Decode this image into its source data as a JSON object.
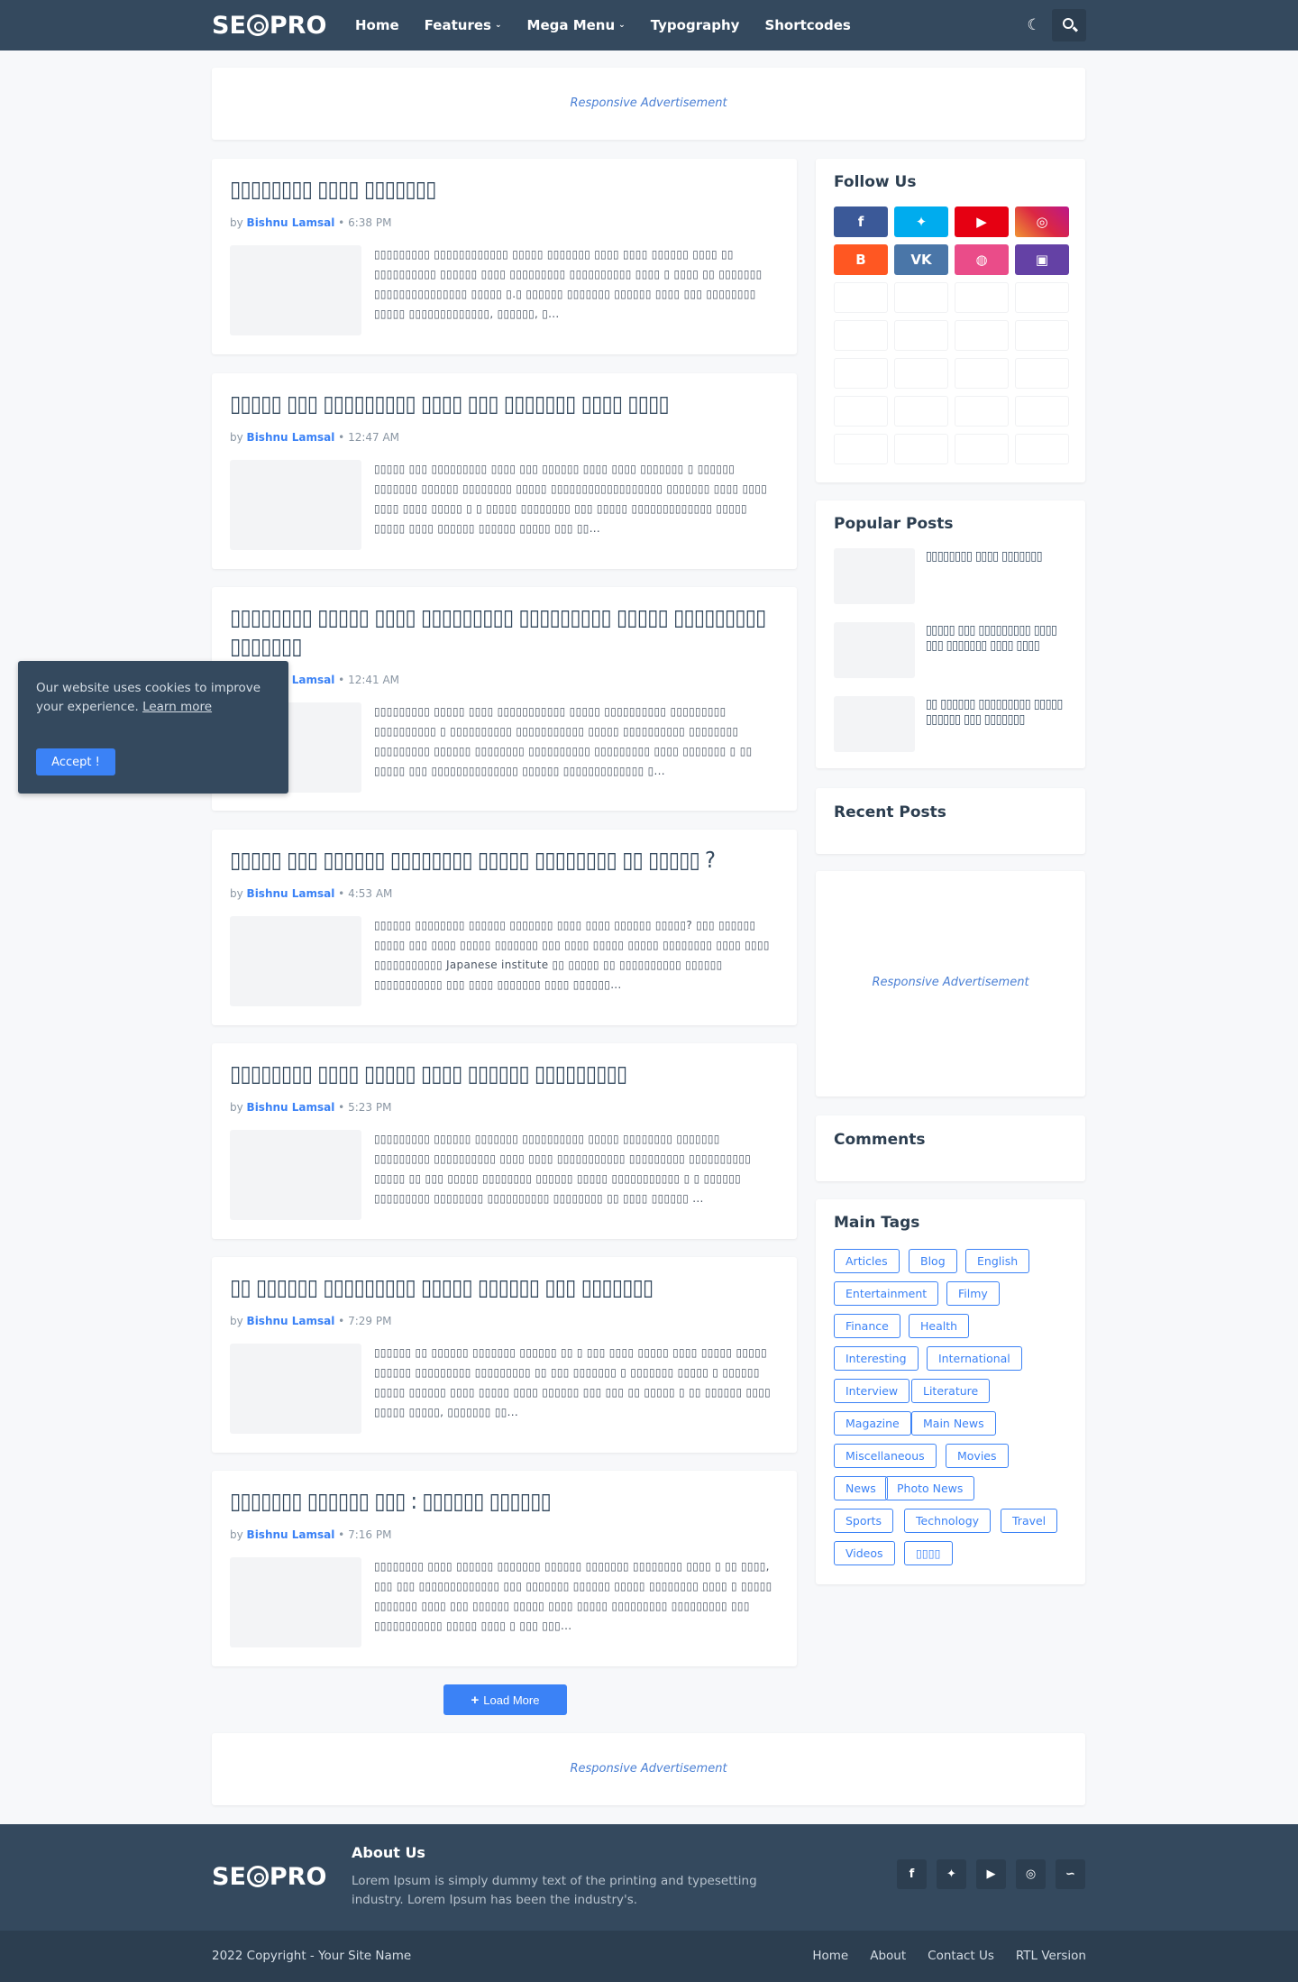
{
  "header": {
    "logo": {
      "left": "SE",
      "right": "PRO"
    },
    "nav": [
      {
        "label": "Home",
        "dropdown": false
      },
      {
        "label": "Features",
        "dropdown": true
      },
      {
        "label": "Mega Menu",
        "dropdown": true
      },
      {
        "label": "Typography",
        "dropdown": false
      },
      {
        "label": "Shortcodes",
        "dropdown": false
      }
    ],
    "icons": {
      "theme": "moon-icon",
      "search": "search-icon"
    }
  },
  "ads": {
    "top": "Responsive Advertisement",
    "sidebar": "Responsive Advertisement",
    "bottom": "Responsive Advertisement"
  },
  "posts": [
    {
      "title": "▯▯▯▯▯▯▯▯ ▯▯▯▯ ▯▯▯▯▯▯▯",
      "author": "Bishnu Lamsal",
      "time": "6:38 PM",
      "excerpt": "▯▯▯▯▯▯▯▯▯ ▯▯▯▯▯▯▯▯▯▯▯▯ ▯▯▯▯▯ ▯▯▯▯▯▯▯ ▯▯▯▯ ▯▯▯▯ ▯▯▯▯▯▯ ▯▯▯▯ ▯▯ ▯▯▯▯▯▯▯▯▯▯ ▯▯▯▯▯▯ ▯▯▯▯ ▯▯▯▯▯▯▯▯▯ ▯▯▯▯▯▯▯▯▯▯ ▯▯▯▯ ▯ ▯▯▯▯ ▯▯ ▯▯▯▯▯▯▯ ▯▯▯▯▯▯▯▯▯▯▯▯▯▯▯ ▯▯▯▯▯ ▯.▯ ▯▯▯▯▯▯ ▯▯▯▯▯▯▯ ▯▯▯▯▯▯ ▯▯▯▯ ▯▯▯ ▯▯▯▯▯▯▯▯ ▯▯▯▯▯ ▯▯▯▯▯▯▯▯▯▯▯▯▯, ▯▯▯▯▯▯, ▯..."
    },
    {
      "title": "▯▯▯▯▯ ▯▯▯ ▯▯▯▯▯▯▯▯▯ ▯▯▯▯ ▯▯▯ ▯▯▯▯▯▯▯ ▯▯▯▯ ▯▯▯▯",
      "author": "Bishnu Lamsal",
      "time": "12:47 AM",
      "excerpt": "▯▯▯▯▯ ▯▯▯ ▯▯▯▯▯▯▯▯▯ ▯▯▯▯ ▯▯▯ ▯▯▯▯▯▯ ▯▯▯▯ ▯▯▯▯ ▯▯▯▯▯▯▯ ▯ ▯▯▯▯▯▯ ▯▯▯▯▯▯▯ ▯▯▯▯▯▯ ▯▯▯▯▯▯▯▯ ▯▯▯▯▯ ▯▯▯▯▯▯▯▯▯▯▯▯▯▯▯▯▯▯ ▯▯▯▯▯▯▯ ▯▯▯▯ ▯▯▯▯ ▯▯▯▯ ▯▯▯▯ ▯▯▯▯▯ ▯ ▯ ▯▯▯▯▯ ▯▯▯▯▯▯▯▯ ▯▯▯ ▯▯▯▯▯ ▯▯▯▯▯▯▯▯▯▯▯▯▯ ▯▯▯▯▯ ▯▯▯▯▯ ▯▯▯▯ ▯▯▯▯▯▯ ▯▯▯▯▯▯ ▯▯▯▯▯ ▯▯▯ ▯▯..."
    },
    {
      "title": "▯▯▯▯▯▯▯▯ ▯▯▯▯▯ ▯▯▯▯ ▯▯▯▯▯▯▯▯▯ ▯▯▯▯▯▯▯▯▯ ▯▯▯▯▯ ▯▯▯▯▯▯▯▯▯ ▯▯▯▯▯▯▯",
      "author": "Bishnu Lamsal",
      "time": "12:41 AM",
      "excerpt": "▯▯▯▯▯▯▯▯▯ ▯▯▯▯▯ ▯▯▯▯ ▯▯▯▯▯▯▯▯▯▯▯ ▯▯▯▯▯ ▯▯▯▯▯▯▯▯▯▯ ▯▯▯▯▯▯▯▯▯ ▯▯▯▯▯▯▯▯▯▯ ▯ ▯▯▯▯▯▯▯▯▯▯ ▯▯▯▯▯▯▯▯▯▯▯ ▯▯▯▯▯ ▯▯▯▯▯▯▯▯▯▯ ▯▯▯▯▯▯▯▯ ▯▯▯▯▯▯▯▯▯ ▯▯▯▯▯▯ ▯▯▯▯▯▯▯▯ ▯▯▯▯▯▯▯▯▯▯ ▯▯▯▯▯▯▯▯▯ ▯▯▯▯ ▯▯▯▯▯▯▯ ▯ ▯▯ ▯▯▯▯▯ ▯▯▯ ▯▯▯▯▯▯▯▯▯▯▯▯▯▯ ▯▯▯▯▯▯ ▯▯▯▯▯▯▯▯▯▯▯▯▯ ▯..."
    },
    {
      "title": "▯▯▯▯▯ ▯▯▯ ▯▯▯▯▯▯ ▯▯▯▯▯▯▯▯ ▯▯▯▯▯ ▯▯▯▯▯▯▯▯ ▯▯ ▯▯▯▯▯ ?",
      "author": "Bishnu Lamsal",
      "time": "4:53 AM",
      "excerpt": "▯▯▯▯▯▯ ▯▯▯▯▯▯▯▯ ▯▯▯▯▯▯ ▯▯▯▯▯▯▯ ▯▯▯▯ ▯▯▯▯ ▯▯▯▯▯▯ ▯▯▯▯▯? ▯▯▯ ▯▯▯▯▯▯ ▯▯▯▯▯ ▯▯▯ ▯▯▯▯ ▯▯▯▯▯ ▯▯▯▯▯▯▯ ▯▯▯ ▯▯▯▯ ▯▯▯▯▯ ▯▯▯▯▯ ▯▯▯▯▯▯▯▯ ▯▯▯▯ ▯▯▯▯ ▯▯▯▯▯▯▯▯▯▯▯ Japanese institute ▯▯ ▯▯▯▯▯ ▯▯ ▯▯▯▯▯▯▯▯▯▯ ▯▯▯▯▯▯ ▯▯▯▯▯▯▯▯▯▯▯ ▯▯▯ ▯▯▯▯ ▯▯▯▯▯▯▯ ▯▯▯▯ ▯▯▯▯▯▯..."
    },
    {
      "title": "▯▯▯▯▯▯▯▯ ▯▯▯▯ ▯▯▯▯▯ ▯▯▯▯ ▯▯▯▯▯▯ ▯▯▯▯▯▯▯▯▯",
      "author": "Bishnu Lamsal",
      "time": "5:23 PM",
      "excerpt": "▯▯▯▯▯▯▯▯▯ ▯▯▯▯▯▯ ▯▯▯▯▯▯▯ ▯▯▯▯▯▯▯▯▯▯ ▯▯▯▯▯ ▯▯▯▯▯▯▯▯ ▯▯▯▯▯▯▯ ▯▯▯▯▯▯▯▯▯ ▯▯▯▯▯▯▯▯▯▯ ▯▯▯▯ ▯▯▯▯ ▯▯▯▯▯▯▯▯▯▯▯ ▯▯▯▯▯▯▯▯▯ ▯▯▯▯▯▯▯▯▯▯ ▯▯▯▯▯ ▯▯ ▯▯▯ ▯▯▯▯▯ ▯▯▯▯▯▯▯▯ ▯▯▯▯▯▯ ▯▯▯▯▯ ▯▯▯▯▯▯▯▯▯▯▯ ▯ ▯ ▯▯▯▯▯▯ ▯▯▯▯▯▯▯▯▯ ▯▯▯▯▯▯▯▯ ▯▯▯▯▯▯▯▯▯▯ ▯▯▯▯▯▯▯▯ ▯▯ ▯▯▯▯ ▯▯▯▯▯▯ ..."
    },
    {
      "title": "▯▯ ▯▯▯▯▯▯ ▯▯▯▯▯▯▯▯▯ ▯▯▯▯▯ ▯▯▯▯▯▯ ▯▯▯ ▯▯▯▯▯▯▯",
      "author": "Bishnu Lamsal",
      "time": "7:29 PM",
      "excerpt": "▯▯▯▯▯▯ ▯▯ ▯▯▯▯▯▯ ▯▯▯▯▯▯▯ ▯▯▯▯▯▯ ▯▯ ▯ ▯▯▯ ▯▯▯▯ ▯▯▯▯▯ ▯▯▯▯ ▯▯▯▯▯ ▯▯▯▯▯ ▯▯▯▯▯▯ ▯▯▯▯▯▯▯▯▯ ▯▯▯▯▯▯▯▯▯ ▯▯ ▯▯▯ ▯▯▯▯▯▯▯ ▯ ▯▯▯▯▯▯▯ ▯▯▯▯▯ ▯ ▯▯▯▯▯▯ ▯▯▯▯▯ ▯▯▯▯▯▯ ▯▯▯▯ ▯▯▯▯▯ ▯▯▯▯ ▯▯▯▯▯▯ ▯▯▯ ▯▯▯ ▯▯ ▯▯▯▯▯ ▯ ▯▯ ▯▯▯▯▯▯ ▯▯▯▯ ▯▯▯▯▯ ▯▯▯▯▯, ▯▯▯▯▯▯▯ ▯▯..."
    },
    {
      "title": "▯▯▯▯▯▯▯ ▯▯▯▯▯▯ ▯▯▯ : ▯▯▯▯▯▯ ▯▯▯▯▯▯",
      "author": "Bishnu Lamsal",
      "time": "7:16 PM",
      "excerpt": "▯▯▯▯▯▯▯▯ ▯▯▯▯ ▯▯▯▯▯▯ ▯▯▯▯▯▯▯ ▯▯▯▯▯▯ ▯▯▯▯▯▯▯ ▯▯▯▯▯▯▯▯ ▯▯▯▯ ▯ ▯▯ ▯▯▯▯, ▯▯▯ ▯▯▯ ▯▯▯▯▯▯▯▯▯▯▯▯▯ ▯▯▯ ▯▯▯▯▯▯▯ ▯▯▯▯▯▯ ▯▯▯▯▯ ▯▯▯▯▯▯▯▯ ▯▯▯▯ ▯ ▯▯▯▯▯ ▯▯▯▯▯▯▯ ▯▯▯▯ ▯▯▯ ▯▯▯▯▯▯ ▯▯▯▯▯ ▯▯▯▯ ▯▯▯▯▯ ▯▯▯▯▯▯▯▯▯ ▯▯▯▯▯▯▯▯▯ ▯▯▯ ▯▯▯▯▯▯▯▯▯▯▯ ▯▯▯▯▯ ▯▯▯▯ ▯ ▯▯▯ ▯▯▯..."
    }
  ],
  "load_more": {
    "icon": "plus-icon",
    "label": "Load More"
  },
  "sidebar": {
    "follow_us": {
      "title": "Follow Us",
      "networks": [
        {
          "name": "facebook-icon",
          "glyph": "f",
          "color": "#3b5998"
        },
        {
          "name": "twitter-icon",
          "glyph": "🐦",
          "color": "#00acee"
        },
        {
          "name": "youtube-icon",
          "glyph": "▶",
          "color": "#e60012"
        },
        {
          "name": "instagram-icon",
          "glyph": "◎",
          "color": "#c13584"
        },
        {
          "name": "blogger-icon",
          "glyph": "B",
          "color": "#ff5722"
        },
        {
          "name": "vk-icon",
          "glyph": "VK",
          "color": "#4a76a8"
        },
        {
          "name": "dribbble-icon",
          "glyph": "◍",
          "color": "#ea4c89"
        },
        {
          "name": "twitch-icon",
          "glyph": "▣",
          "color": "#6441a5"
        }
      ]
    },
    "popular_posts": {
      "title": "Popular Posts",
      "items": [
        "▯▯▯▯▯▯▯▯ ▯▯▯▯ ▯▯▯▯▯▯▯",
        "▯▯▯▯▯ ▯▯▯ ▯▯▯▯▯▯▯▯▯ ▯▯▯▯ ▯▯▯ ▯▯▯▯▯▯▯ ▯▯▯▯ ▯▯▯▯",
        "▯▯ ▯▯▯▯▯▯ ▯▯▯▯▯▯▯▯▯ ▯▯▯▯▯ ▯▯▯▯▯▯ ▯▯▯ ▯▯▯▯▯▯▯"
      ]
    },
    "recent_posts": {
      "title": "Recent Posts"
    },
    "comments": {
      "title": "Comments"
    },
    "main_tags": {
      "title": "Main Tags",
      "tags": [
        "Articles",
        "Blog",
        "English",
        "Entertainment",
        "Filmy",
        "Finance",
        "Health",
        "Interesting",
        "International",
        "Interview",
        "Literature",
        "Magazine",
        "Main News",
        "Miscellaneous",
        "Movies",
        "News",
        "Photo News",
        "Sports",
        "Technology",
        "Travel",
        "Videos",
        "▯▯▯▯"
      ]
    }
  },
  "cookie": {
    "text": "Our website uses cookies to improve your experience.",
    "link": "Learn more",
    "button": "Accept !"
  },
  "footer": {
    "about_title": "About Us",
    "about_text": "Lorem Ipsum is simply dummy text of the printing and typesetting industry. Lorem Ipsum has been the industry's.",
    "social": [
      {
        "name": "facebook-icon",
        "glyph": "f"
      },
      {
        "name": "twitter-icon",
        "glyph": "🐦"
      },
      {
        "name": "youtube-icon",
        "glyph": "▶"
      },
      {
        "name": "instagram-icon",
        "glyph": "◎"
      },
      {
        "name": "rss-icon",
        "glyph": "◠"
      }
    ],
    "copyright": "2022 Copyright - Your Site Name",
    "links": [
      "Home",
      "About",
      "Contact Us",
      "RTL Version"
    ]
  },
  "colors": {
    "header": "#34495e",
    "accent": "#3b82f6",
    "background": "#f7f8fa"
  }
}
